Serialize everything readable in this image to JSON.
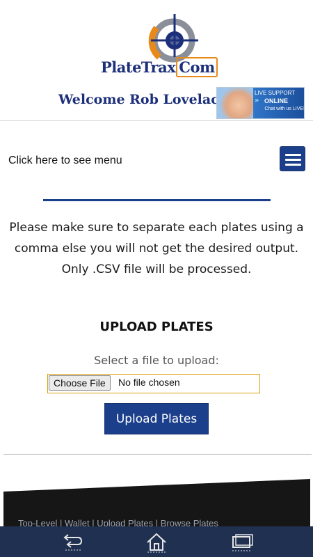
{
  "header": {
    "logo": {
      "name": "PlateTrax",
      "suffix": "Com"
    },
    "welcome": "Welcome Rob Lovelace!",
    "live_support": {
      "title": "LIVE SUPPORT",
      "status": "ONLINE",
      "subtitle": "Chat with us LIVE!"
    }
  },
  "menu": {
    "label": "Click here to see menu"
  },
  "notice": "Please make sure to separate each plates using a comma else you will not get the desired output. Only .CSV file will be processed.",
  "upload": {
    "heading": "UPLOAD PLATES",
    "select_label": "Select a file to upload:",
    "choose_button": "Choose File",
    "file_status": "No file chosen",
    "submit_label": "Upload Plates"
  },
  "footer": {
    "links_text": "Top-Level | Wallet | Upload Plates | Browse Plates"
  },
  "bottom_nav": [
    "back-icon",
    "home-icon",
    "screen-icon"
  ],
  "colors": {
    "brand_blue": "#1c3f8c",
    "accent_orange": "#e88a1a",
    "nav_bar": "#1f3050"
  }
}
